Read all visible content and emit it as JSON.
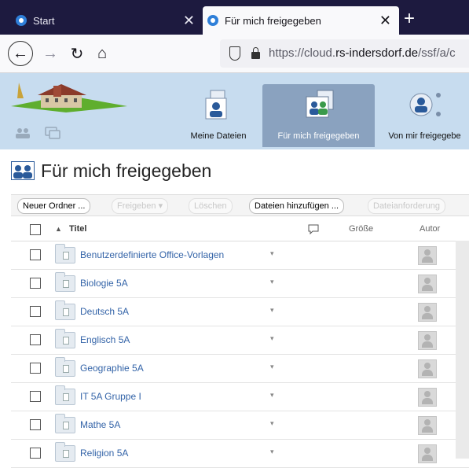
{
  "browser": {
    "tabs": [
      {
        "label": "Start",
        "close": "✕"
      },
      {
        "label": "Für mich freigegeben",
        "close": "✕"
      }
    ],
    "new_tab": "+",
    "url_prefix": "https://cloud.",
    "url_domain": "rs-indersdorf.de",
    "url_path": "/ssf/a/c"
  },
  "app_nav": {
    "items": [
      {
        "label": "Meine Dateien"
      },
      {
        "label": "Für mich freigegeben"
      },
      {
        "label": "Von mir freigegebe"
      }
    ]
  },
  "page": {
    "title": "Für mich freigegeben"
  },
  "toolbar": {
    "new_folder": "Neuer Ordner ...",
    "share": "Freigeben ▾",
    "delete": "Löschen",
    "add_files": "Dateien hinzufügen ...",
    "file_request": "Dateianforderung"
  },
  "table": {
    "headers": {
      "sort_arrow": "▲",
      "title": "Titel",
      "size": "Größe",
      "author": "Autor"
    },
    "rows": [
      {
        "name": "Benutzerdefinierte Office-Vorlagen"
      },
      {
        "name": "Biologie 5A"
      },
      {
        "name": "Deutsch 5A"
      },
      {
        "name": "Englisch 5A"
      },
      {
        "name": "Geographie 5A"
      },
      {
        "name": "IT 5A Gruppe I"
      },
      {
        "name": "Mathe 5A"
      },
      {
        "name": "Religion 5A"
      }
    ],
    "row_dropdown": "▾"
  },
  "colors": {
    "tabbar_bg": "#1d1a3f",
    "header_bg": "#c7dcef",
    "active_nav_bg": "#8aa2bf",
    "link_color": "#3464a8"
  }
}
